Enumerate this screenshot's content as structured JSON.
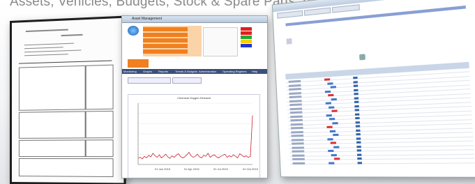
{
  "caption": "Assets, Vehicles, Budgets, Stock & Spare Parts, etc.",
  "app_window": {
    "title": "Asset Management",
    "menu": [
      "Monitoring",
      "Graphs",
      "Reports",
      "Trends & Budgets",
      "Administration",
      "Operating Regimes",
      "Help"
    ],
    "chart_title": "Chemical Oxygen Demand",
    "x_ticks": [
      "01 Jan 2015",
      "01 Apr 2015",
      "01 Jul 2015",
      "01 Oct 2015"
    ],
    "colors": {
      "accent": "#f08020",
      "series": "#cc1f2a",
      "menubar": "#3b4f7a"
    }
  },
  "chart_data": {
    "type": "line",
    "series": [
      {
        "values": [
          12,
          14,
          11,
          16,
          13,
          18,
          15,
          22,
          17,
          14,
          19,
          13,
          16,
          20,
          15,
          12,
          17,
          14,
          18,
          21,
          16,
          13,
          15,
          19,
          24,
          17,
          14,
          16,
          20,
          15,
          13,
          18,
          16,
          22,
          14,
          17,
          19,
          15,
          13,
          16,
          18,
          20,
          14,
          17,
          15,
          19,
          16,
          13,
          21,
          18,
          15,
          17,
          14,
          16,
          96
        ]
      }
    ],
    "ylim": [
      0,
      120
    ],
    "grid": true
  }
}
